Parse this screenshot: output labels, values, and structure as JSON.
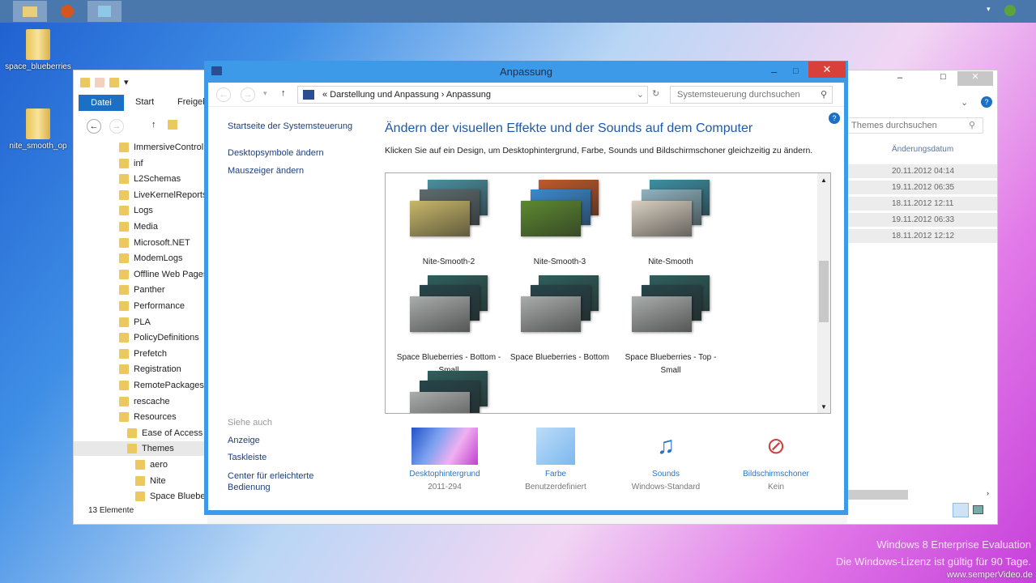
{
  "taskbar": {
    "items": [
      "file-explorer",
      "firefox",
      "control-panel"
    ]
  },
  "desktop": {
    "icons": [
      "space_blueberries",
      "nite_smooth_op"
    ],
    "watermark": {
      "line1": "Windows 8 Enterprise Evaluation",
      "line2": "Die Windows-Lizenz ist gültig für 90 Tage.",
      "site": "www.semperVideo.de"
    }
  },
  "explorer": {
    "ribbon_tabs": [
      "Datei",
      "Start",
      "Freigeben"
    ],
    "search_placeholder": "Themes durchsuchen",
    "column_header": "Änderungsdatum",
    "tree": [
      "ImmersiveControlPanel",
      "inf",
      "L2Schemas",
      "LiveKernelReports",
      "Logs",
      "Media",
      "Microsoft.NET",
      "ModemLogs",
      "Offline Web Pages",
      "Panther",
      "Performance",
      "PLA",
      "PolicyDefinitions",
      "Prefetch",
      "Registration",
      "RemotePackages",
      "rescache",
      "Resources",
      "Ease of Access Themes",
      "Themes",
      "aero",
      "Nite",
      "Space Blueberries"
    ],
    "dates": [
      "20.11.2012 04:14",
      "19.11.2012 06:35",
      "18.11.2012 12:11",
      "19.11.2012 06:33",
      "18.11.2012 12:12"
    ],
    "status": "13 Elemente"
  },
  "window": {
    "title": "Anpassung",
    "breadcrumb": [
      "Darstellung und Anpassung",
      "Anpassung"
    ],
    "search_placeholder": "Systemsteuerung durchsuchen",
    "sidebar": {
      "home": "Startseite der Systemsteuerung",
      "links": [
        "Desktopsymbole ändern",
        "Mauszeiger ändern"
      ],
      "see_also_title": "Siehe auch",
      "see_also": [
        "Anzeige",
        "Taskleiste",
        "Center für erleichterte Bedienung"
      ]
    },
    "heading": "Ändern der visuellen Effekte und der Sounds auf dem Computer",
    "description": "Klicken Sie auf ein Design, um Desktophintergrund, Farbe, Sounds und Bildschirmschoner gleichzeitig zu ändern.",
    "themes": [
      {
        "name": "Nite-Smooth-2",
        "colors": [
          "#4b8fa0",
          "#5f6b6d",
          "#c8b86a"
        ]
      },
      {
        "name": "Nite-Smooth-3",
        "colors": [
          "#c05a2a",
          "#3a8ad0",
          "#5c8a30"
        ]
      },
      {
        "name": "Nite-Smooth",
        "colors": [
          "#3d8fa3",
          "#8fb3c0",
          "#d8cfc0"
        ]
      },
      {
        "name": "Space Blueberries - Bottom - Small",
        "colors": [
          "#2e5f5c",
          "#27454a",
          "#a9adab"
        ]
      },
      {
        "name": "Space Blueberries - Bottom",
        "colors": [
          "#2e5f5c",
          "#27454a",
          "#a9adab"
        ]
      },
      {
        "name": "Space Blueberries - Top - Small",
        "colors": [
          "#2e5f5c",
          "#27454a",
          "#a9adab"
        ]
      },
      {
        "name": "",
        "colors": [
          "#2e5f5c",
          "#27454a",
          "#a9adab"
        ]
      }
    ],
    "bottom": [
      {
        "label": "Desktophintergrund",
        "value": "2011-294"
      },
      {
        "label": "Farbe",
        "value": "Benutzerdefiniert"
      },
      {
        "label": "Sounds",
        "value": "Windows-Standard"
      },
      {
        "label": "Bildschirmschoner",
        "value": "Kein"
      }
    ]
  }
}
